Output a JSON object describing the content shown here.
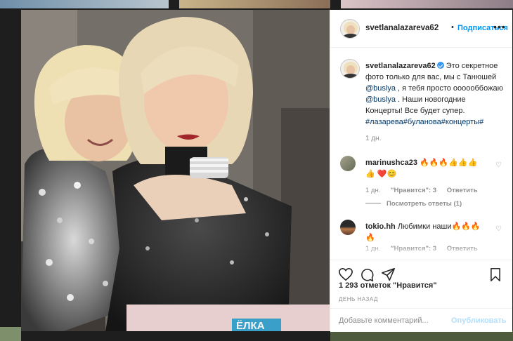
{
  "header": {
    "username": "svetlanalazareva62",
    "separator": "•",
    "follow_label": "Подписаться",
    "more_label": "•••"
  },
  "caption": {
    "username": "svetlanalazareva62",
    "text_1": " Это секретное фото только для вас, мы с Танюшей ",
    "mention_1": "@buslya",
    "text_2": " , я тебя просто оооооббожаю ",
    "mention_2": "@buslya",
    "text_3": " . Наши новогодние Концерты! Все будет супер. ",
    "hashtags": "#лазарева#буланова#концерты#",
    "time": "1 дн."
  },
  "comments": [
    {
      "username": "marinushca23",
      "text": " 🔥🔥🔥👍👍👍👍 ❤️😊",
      "time": "1 дн.",
      "likes": "\"Нравится\": 3",
      "reply": "Ответить",
      "view_replies": "Посмотреть ответы (1)"
    },
    {
      "username": "tokio.hh",
      "text": " Любимки наши🔥🔥🔥 🔥",
      "time": "1 дн.",
      "likes": "\"Нравится\": 3",
      "reply": "Ответить"
    }
  ],
  "actions": {
    "likes": "1 293 отметок \"Нравится\"",
    "date": "ДЕНЬ НАЗАД",
    "comment_placeholder": "Добавьте комментарий...",
    "publish_label": "Опубликовать"
  },
  "photo": {
    "banner_text": "ЁЛКА"
  },
  "colors": {
    "accent": "#0095f6",
    "text": "#262626",
    "muted": "#8e8e8e",
    "link": "#00376b",
    "publish_disabled": "#b2dffc"
  }
}
